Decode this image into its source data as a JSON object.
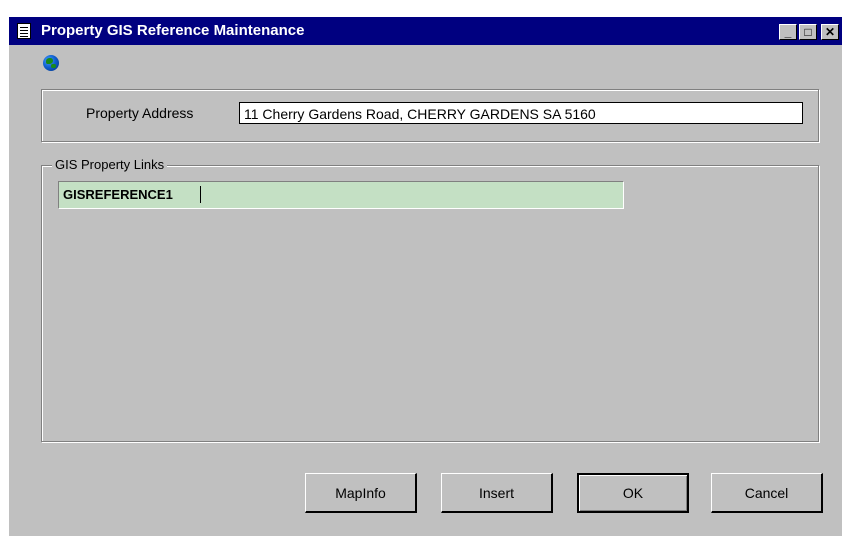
{
  "window": {
    "title": "Property GIS Reference Maintenance",
    "minimize_glyph": "_",
    "maximize_glyph": "□",
    "close_glyph": "✕",
    "title_icon": "document-icon",
    "toolbar_icon": "globe-icon"
  },
  "address_group": {
    "label": "Property Address",
    "value": "11 Cherry Gardens Road, CHERRY GARDENS SA  5160"
  },
  "links_group": {
    "caption": "GIS Property Links",
    "items": [
      "GISREFERENCE1"
    ]
  },
  "buttons": {
    "mapinfo": "MapInfo",
    "insert": "Insert",
    "ok": "OK",
    "cancel": "Cancel"
  },
  "colors": {
    "titlebar": "#000080",
    "window_bg": "#c0c0c0",
    "link_field_bg": "#c4e0c4"
  }
}
